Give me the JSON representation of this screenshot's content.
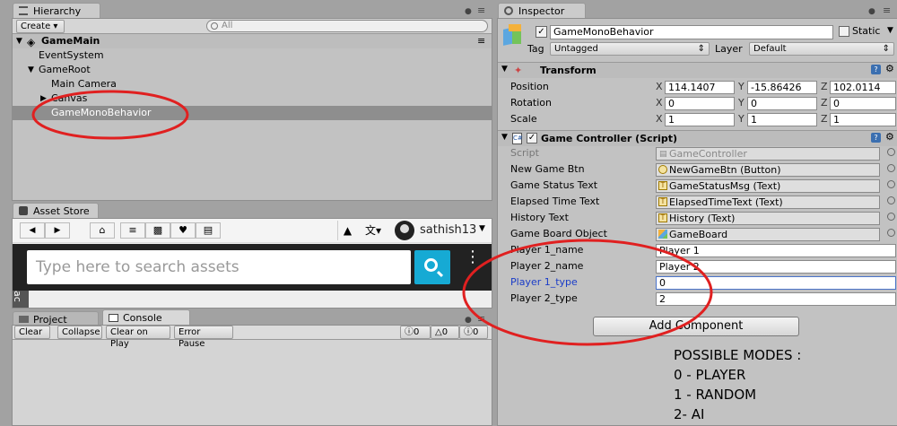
{
  "hierarchy": {
    "tab_label": "Hierarchy",
    "create_label": "Create",
    "search_placeholder": "All",
    "scene_name": "GameMain",
    "items": [
      "EventSystem",
      "GameRoot",
      "Main Camera",
      "Canvas",
      "GameMonoBehavior"
    ]
  },
  "asset_store": {
    "tab_label": "Asset Store",
    "username": "sathish13",
    "search_placeholder": "Type here to search assets",
    "side_text": "ac"
  },
  "console": {
    "tabs": [
      "Project",
      "Console"
    ],
    "buttons": [
      "Clear",
      "Collapse",
      "Clear on Play",
      "Error Pause"
    ],
    "counts": [
      "0",
      "0",
      "0"
    ]
  },
  "inspector": {
    "tab_label": "Inspector",
    "object_name": "GameMonoBehavior",
    "static_label": "Static",
    "tag_label": "Tag",
    "tag_value": "Untagged",
    "layer_label": "Layer",
    "layer_value": "Default",
    "transform": {
      "title": "Transform",
      "rows": [
        {
          "label": "Position",
          "x": "114.1407",
          "y": "-15.86426",
          "z": "102.0114"
        },
        {
          "label": "Rotation",
          "x": "0",
          "y": "0",
          "z": "0"
        },
        {
          "label": "Scale",
          "x": "1",
          "y": "1",
          "z": "1"
        }
      ],
      "axes": [
        "X",
        "Y",
        "Z"
      ]
    },
    "script_component": {
      "title": "Game Controller (Script)",
      "rows": [
        {
          "label": "Script",
          "value": "GameController"
        },
        {
          "label": "New Game Btn",
          "value": "NewGameBtn (Button)"
        },
        {
          "label": "Game Status Text",
          "value": "GameStatusMsg (Text)"
        },
        {
          "label": "Elapsed Time Text",
          "value": "ElapsedTimeText (Text)"
        },
        {
          "label": "History Text",
          "value": "History (Text)"
        },
        {
          "label": "Game Board Object",
          "value": "GameBoard"
        },
        {
          "label": "Player 1_name",
          "value": "Player 1"
        },
        {
          "label": "Player 2_name",
          "value": "Player 2"
        },
        {
          "label": "Player 1_type",
          "value": "0"
        },
        {
          "label": "Player 2_type",
          "value": "2"
        }
      ]
    },
    "add_component_label": "Add Component",
    "notes": [
      "POSSIBLE MODES :",
      "0 - PLAYER",
      "1 - RANDOM",
      "2- AI"
    ]
  },
  "colors": {
    "annotation": "#e02020",
    "selection": "#8e8e8e",
    "highlight_label": "#1a3cc8",
    "search_button": "#16aad4"
  }
}
